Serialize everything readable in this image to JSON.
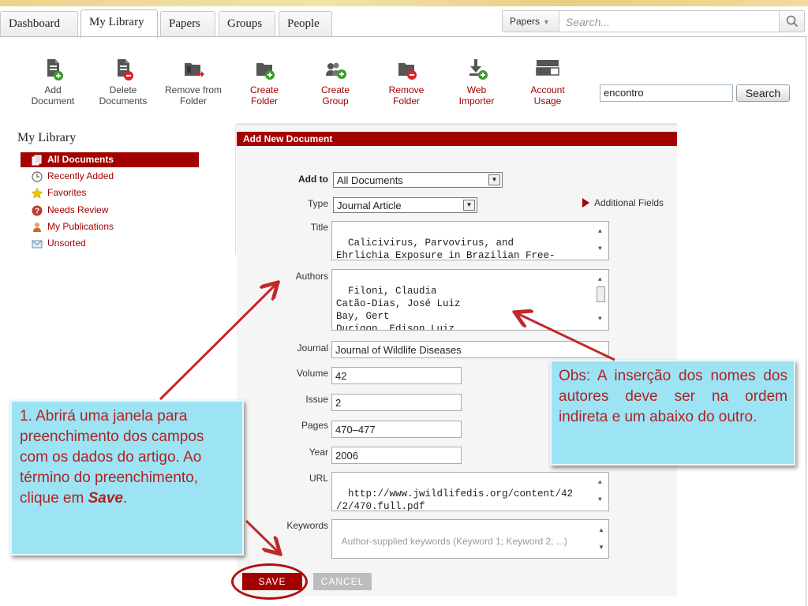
{
  "tabs": [
    {
      "label": "Dashboard",
      "active": false
    },
    {
      "label": "My Library",
      "active": true
    },
    {
      "label": "Papers",
      "active": false
    },
    {
      "label": "Groups",
      "active": false
    },
    {
      "label": "People",
      "active": false
    }
  ],
  "top_search": {
    "type_label": "Papers",
    "placeholder": "Search..."
  },
  "toolbar": [
    {
      "label": "Add\nDocument",
      "icon": "add-document-icon",
      "style": "gray"
    },
    {
      "label": "Delete\nDocuments",
      "icon": "delete-documents-icon",
      "style": "gray"
    },
    {
      "label": "Remove from\nFolder",
      "icon": "remove-from-folder-icon",
      "style": "gray"
    },
    {
      "label": "Create\nFolder",
      "icon": "create-folder-icon",
      "style": "red"
    },
    {
      "label": "Create\nGroup",
      "icon": "create-group-icon",
      "style": "red"
    },
    {
      "label": "Remove\nFolder",
      "icon": "remove-folder-icon",
      "style": "red"
    },
    {
      "label": "Web\nImporter",
      "icon": "web-importer-icon",
      "style": "red"
    },
    {
      "label": "Account\nUsage",
      "icon": "account-usage-icon",
      "style": "red"
    }
  ],
  "quick_search": {
    "value": "encontro",
    "button": "Search"
  },
  "library": {
    "title": "My Library",
    "items": [
      {
        "label": "All Documents",
        "icon": "all-documents-icon",
        "active": true
      },
      {
        "label": "Recently Added",
        "icon": "clock-icon",
        "active": false
      },
      {
        "label": "Favorites",
        "icon": "star-icon",
        "active": false
      },
      {
        "label": "Needs Review",
        "icon": "review-icon",
        "active": false
      },
      {
        "label": "My Publications",
        "icon": "person-icon",
        "active": false
      },
      {
        "label": "Unsorted",
        "icon": "inbox-icon",
        "active": false
      }
    ]
  },
  "form": {
    "header": "Add New Document",
    "add_to_label": "Add to",
    "add_to_value": "All Documents",
    "type_label": "Type",
    "type_value": "Journal Article",
    "additional_fields": "Additional Fields",
    "title_label": "Title",
    "title_value": "Calicivirus, Parvovirus, and\nEhrlichia Exposure in Brazilian Free-\nranging Felids",
    "authors_label": "Authors",
    "authors_value": "Filoni, Claudia\nCatão-Dias, José Luiz\nBay, Gert\nDurigon, Edison Luiz\nJorge, Rodrigo Silva Pinto",
    "journal_label": "Journal",
    "journal_value": "Journal of Wildlife Diseases",
    "volume_label": "Volume",
    "volume_value": "42",
    "issue_label": "Issue",
    "issue_value": "2",
    "pages_label": "Pages",
    "pages_value": "470–477",
    "year_label": "Year",
    "year_value": "2006",
    "url_label": "URL",
    "url_value": "http://www.jwildlifedis.org/content/42\n/2/470.full.pdf",
    "keywords_label": "Keywords",
    "keywords_placeholder": "Author-supplied keywords (Keyword 1; Keyword 2; ...)",
    "save": "SAVE",
    "cancel": "CANCEL"
  },
  "callouts": {
    "left_before": "1. Abrirá uma janela para preenchimento dos campos com os dados do artigo. Ao término do preenchimento, clique em ",
    "left_emph": "Save",
    "left_after": ".",
    "right": "Obs: A inserção dos nomes dos autores  deve ser na ordem indireta e um abaixo do outro."
  },
  "colors": {
    "brand_red": "#a30000",
    "callout_bg": "#9ce4f4",
    "callout_text": "#b22222",
    "arrow": "#c0282a"
  }
}
